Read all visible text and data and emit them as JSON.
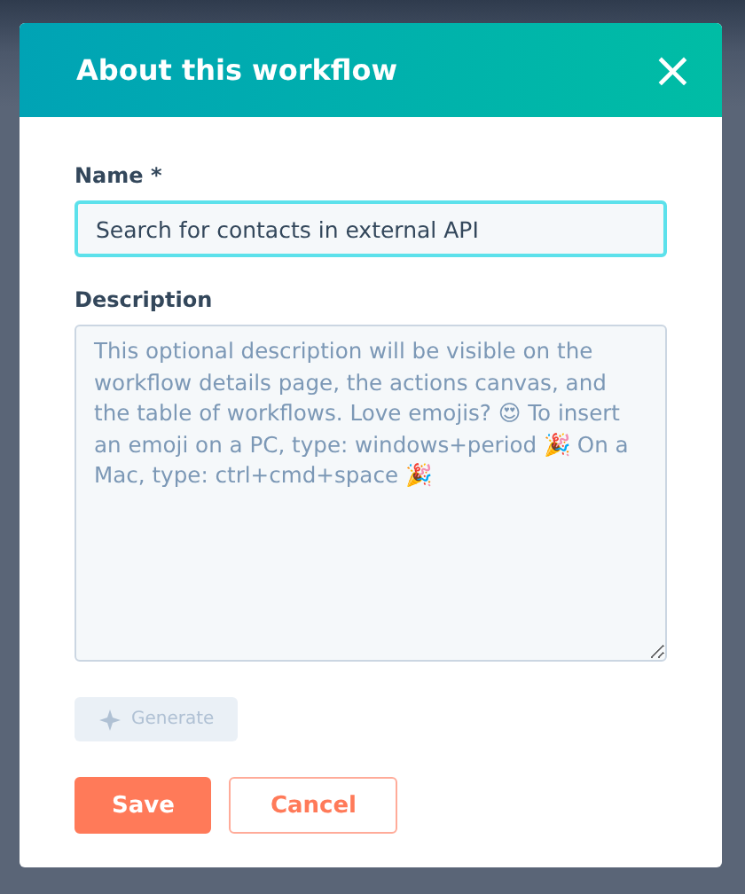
{
  "dialog": {
    "title": "About this workflow",
    "close": "×"
  },
  "fields": [
    {
      "kind": "input",
      "label": "Name *",
      "value": "Search for contacts in external API"
    },
    {
      "kind": "textarea",
      "label": "Description",
      "placeholder": "This optional description will be visible on the workflow details page, the actions canvas, and the table of workflows. Love emojis? 😍 To insert an emoji on a PC, type: windows+period 🎉 On a Mac, type: ctrl+cmd+space 🎉"
    }
  ],
  "generate": {
    "label": "Generate",
    "disabled": true
  },
  "buttons": [
    {
      "kind": "primary",
      "label": "Save"
    },
    {
      "kind": "secondary",
      "label": "Cancel"
    }
  ]
}
